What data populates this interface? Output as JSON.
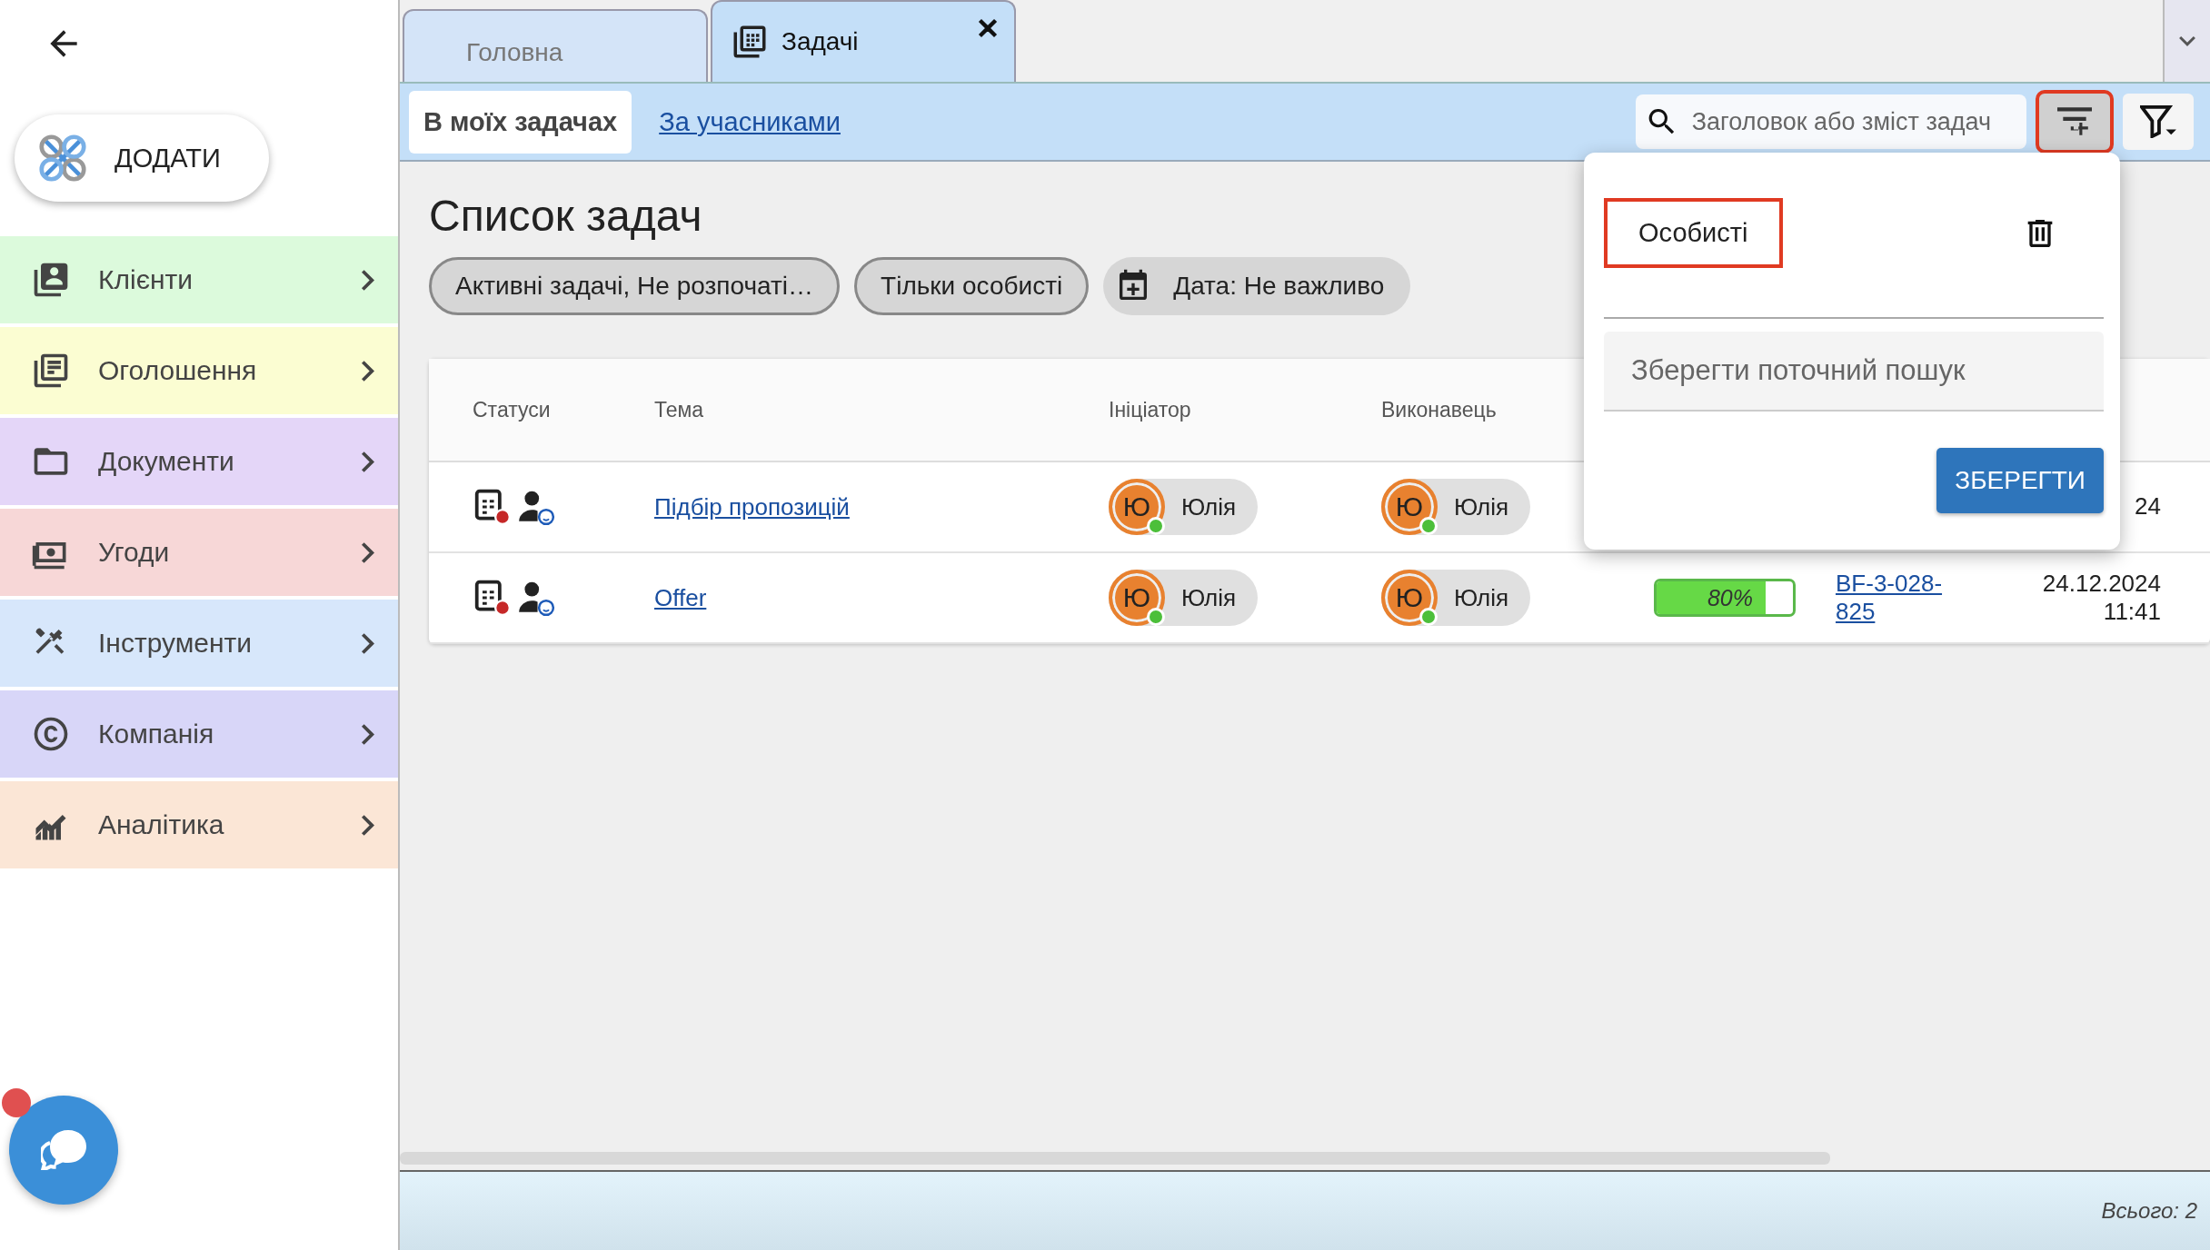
{
  "sidebar": {
    "add_button": "ДОДАТИ",
    "items": [
      {
        "label": "Клієнти",
        "color": "#dcfadc"
      },
      {
        "label": "Оголошення",
        "color": "#fbfdd2"
      },
      {
        "label": "Документи",
        "color": "#e4d6f8"
      },
      {
        "label": "Угоди",
        "color": "#f7d7d7"
      },
      {
        "label": "Інструменти",
        "color": "#d7e7fb"
      },
      {
        "label": "Компанія",
        "color": "#d8d6f8"
      },
      {
        "label": "Аналітика",
        "color": "#fbe6d6"
      }
    ],
    "chat": {
      "unread": true
    }
  },
  "tabs": [
    {
      "label": "Головна",
      "selected": false,
      "closable": false
    },
    {
      "label": "Задачі",
      "selected": true,
      "closable": true
    }
  ],
  "subtabs": [
    {
      "label": "В моїх задачах",
      "selected": true
    },
    {
      "label": "За учасниками",
      "selected": false
    }
  ],
  "search": {
    "placeholder": "Заголовок або зміст задач"
  },
  "save_search_button": {
    "highlighted": true
  },
  "page_title": "Список задач",
  "filters": [
    {
      "label": "Активні задачі, Не розпочаті…",
      "kind": "outlined"
    },
    {
      "label": "Тільки особисті",
      "kind": "outlined"
    },
    {
      "label": "Дата: Не важливо",
      "kind": "date"
    }
  ],
  "table": {
    "columns": [
      "Статуси",
      "Тема",
      "Ініціатор",
      "Виконавець"
    ],
    "rows": [
      {
        "topic": "Підбір пропозицій",
        "initiator": {
          "initial": "Ю",
          "name": "Юлія",
          "online": true
        },
        "assignee": {
          "initial": "Ю",
          "name": "Юлія",
          "online": true
        },
        "date": "24"
      },
      {
        "topic": "Offer",
        "initiator": {
          "initial": "Ю",
          "name": "Юлія",
          "online": true
        },
        "assignee": {
          "initial": "Ю",
          "name": "Юлія",
          "online": true
        },
        "progress": {
          "level": 0.8,
          "label": "80%"
        },
        "reference": "BF-3-028-825",
        "date": "24.12.2024 11:41"
      }
    ]
  },
  "saved_searches_popup": {
    "items": [
      {
        "label": "Особисті",
        "highlighted": true
      }
    ],
    "name_field": {
      "placeholder": "Зберегти поточний пошук"
    },
    "save_button": "ЗБЕРЕГТИ"
  },
  "footer": {
    "total": "Всього: 2"
  }
}
